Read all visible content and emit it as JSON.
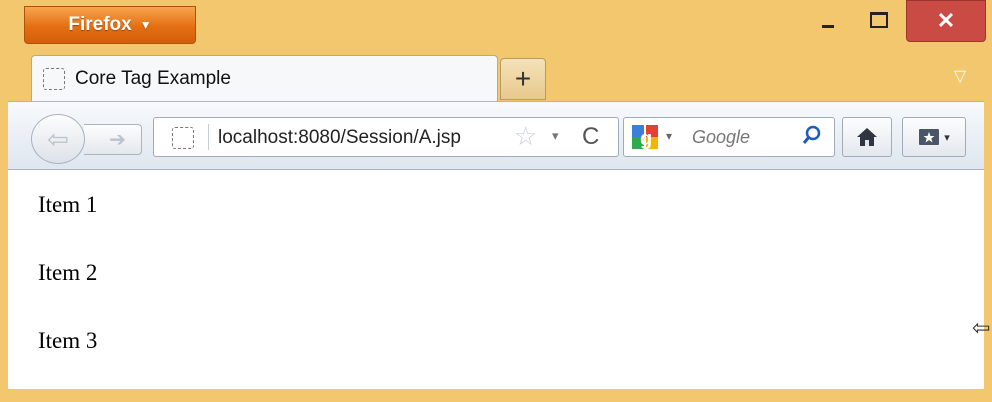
{
  "titlebar": {
    "firefox_label": "Firefox",
    "firefox_caret": "▼",
    "minimize_glyph": "",
    "maximize_glyph": "",
    "close_glyph": "✕"
  },
  "tabs": [
    {
      "label": "Core Tag Example",
      "icon": "blank-page-icon"
    }
  ],
  "newtab_glyph": "+",
  "tablist_glyph": "▽",
  "navigation": {
    "back_glyph": "⇦",
    "forward_glyph": "➔"
  },
  "urlbar": {
    "url": "localhost:8080/Session/A.jsp",
    "star_glyph": "☆",
    "drop_glyph": "▾",
    "reload_glyph": "C"
  },
  "search": {
    "placeholder": "Google",
    "drop_glyph": "▾",
    "magnifier_glyph": "⚲"
  },
  "content": {
    "items": [
      "Item 1",
      "Item 2",
      "Item 3"
    ]
  },
  "cursor_glyph": "⇦",
  "colors": {
    "frame": "#f3c76e",
    "firefox_button": "#e46f12",
    "close_button": "#c94b44"
  }
}
